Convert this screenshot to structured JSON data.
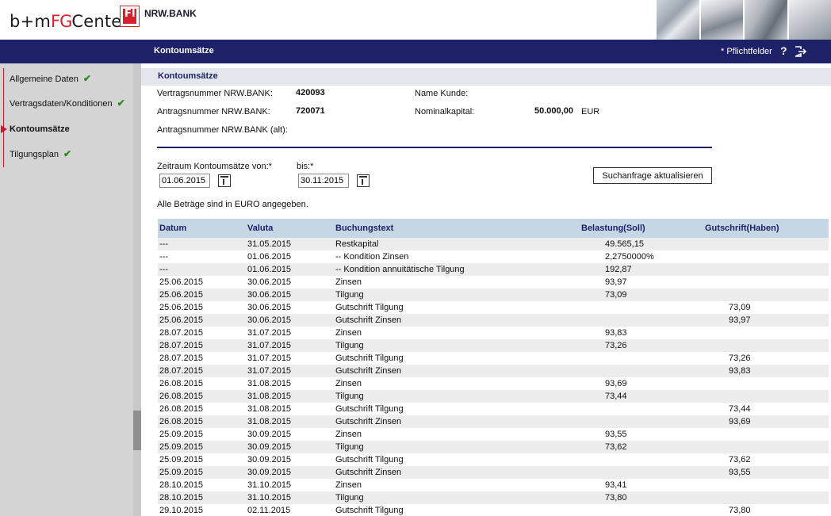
{
  "header": {
    "logo_prefix": "b+m",
    "logo_fg": "FG",
    "logo_suffix": "Center",
    "logo_box": "FI",
    "bank_name": "NRW.BANK"
  },
  "titlebar": {
    "title": "Kontoumsätze",
    "required_note": "* Pflichtfelder",
    "help": "?"
  },
  "sidebar": {
    "items": [
      {
        "label": "Allgemeine Daten",
        "done": true
      },
      {
        "label": "Vertragsdaten/Konditionen",
        "done": true
      },
      {
        "label": "Kontoumsätze",
        "done": false,
        "active": true
      },
      {
        "label": "Tilgungsplan",
        "done": true
      }
    ],
    "check_glyph": "✔"
  },
  "main": {
    "section_title": "Kontoumsätze",
    "vertrag_label": "Vertragsnummer NRW.BANK:",
    "vertrag_value": "420093",
    "antrag_label": "Antragsnummer NRW.BANK:",
    "antrag_value": "720071",
    "antrag_alt_label": "Antragsnummer NRW.BANK (alt):",
    "kunde_label": "Name Kunde:",
    "nominal_label": "Nominalkapital:",
    "nominal_value": "50.000,00",
    "nominal_currency": "EUR",
    "zeitraum_label": "Zeitraum Kontoumsätze von:*",
    "bis_label": "bis:*",
    "von_value": "01.06.2015",
    "bis_value": "30.11.2015",
    "refresh_button": "Suchanfrage aktualisieren",
    "note": "Alle Beträge sind in EURO angegeben."
  },
  "table": {
    "headers": [
      "Datum",
      "Valuta",
      "Buchungstext",
      "Belastung(Soll)",
      "Gutschrift(Haben)"
    ],
    "rows": [
      [
        "---",
        "31.05.2015",
        "Restkapital",
        "49.565,15",
        ""
      ],
      [
        "---",
        "01.06.2015",
        "-- Kondition Zinsen",
        "2,2750000%",
        ""
      ],
      [
        "---",
        "01.06.2015",
        "-- Kondition annuitätische Tilgung",
        "192,87",
        ""
      ],
      [
        "25.06.2015",
        "30.06.2015",
        "Zinsen",
        "93,97",
        ""
      ],
      [
        "25.06.2015",
        "30.06.2015",
        "Tilgung",
        "73,09",
        ""
      ],
      [
        "25.06.2015",
        "30.06.2015",
        "Gutschrift Tilgung",
        "",
        "73,09"
      ],
      [
        "25.06.2015",
        "30.06.2015",
        "Gutschrift Zinsen",
        "",
        "93,97"
      ],
      [
        "28.07.2015",
        "31.07.2015",
        "Zinsen",
        "93,83",
        ""
      ],
      [
        "28.07.2015",
        "31.07.2015",
        "Tilgung",
        "73,26",
        ""
      ],
      [
        "28.07.2015",
        "31.07.2015",
        "Gutschrift Tilgung",
        "",
        "73,26"
      ],
      [
        "28.07.2015",
        "31.07.2015",
        "Gutschrift Zinsen",
        "",
        "93,83"
      ],
      [
        "26.08.2015",
        "31.08.2015",
        "Zinsen",
        "93,69",
        ""
      ],
      [
        "26.08.2015",
        "31.08.2015",
        "Tilgung",
        "73,44",
        ""
      ],
      [
        "26.08.2015",
        "31.08.2015",
        "Gutschrift Tilgung",
        "",
        "73,44"
      ],
      [
        "26.08.2015",
        "31.08.2015",
        "Gutschrift Zinsen",
        "",
        "93,69"
      ],
      [
        "25.09.2015",
        "30.09.2015",
        "Zinsen",
        "93,55",
        ""
      ],
      [
        "25.09.2015",
        "30.09.2015",
        "Tilgung",
        "73,62",
        ""
      ],
      [
        "25.09.2015",
        "30.09.2015",
        "Gutschrift Tilgung",
        "",
        "73,62"
      ],
      [
        "25.09.2015",
        "30.09.2015",
        "Gutschrift Zinsen",
        "",
        "93,55"
      ],
      [
        "28.10.2015",
        "31.10.2015",
        "Zinsen",
        "93,41",
        ""
      ],
      [
        "28.10.2015",
        "31.10.2015",
        "Tilgung",
        "73,80",
        ""
      ],
      [
        "29.10.2015",
        "02.11.2015",
        "Gutschrift Tilgung",
        "",
        "73,80"
      ]
    ]
  },
  "colors": {
    "navy": "#1d2268",
    "brand_red": "#d6202b",
    "check_green": "#2b8a1f",
    "table_header": "#c7d6e4",
    "row_alt": "#ececec"
  }
}
